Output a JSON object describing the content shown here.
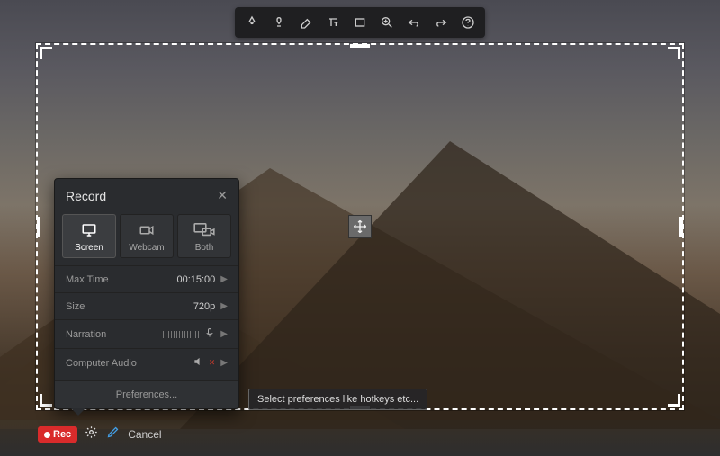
{
  "toolbar": {
    "icons": [
      "pen-tool",
      "highlighter",
      "eraser",
      "text",
      "rectangle",
      "zoom",
      "undo",
      "redo",
      "help"
    ]
  },
  "panel": {
    "title": "Record",
    "sources": [
      {
        "label": "Screen",
        "icon": "monitor-icon",
        "active": true
      },
      {
        "label": "Webcam",
        "icon": "webcam-icon",
        "active": false
      },
      {
        "label": "Both",
        "icon": "both-icon",
        "active": false
      }
    ],
    "rows": {
      "maxtime_label": "Max Time",
      "maxtime_value": "00:15:00",
      "size_label": "Size",
      "size_value": "720p",
      "narration_label": "Narration",
      "audio_label": "Computer Audio"
    },
    "prefs_label": "Preferences..."
  },
  "tooltip": "Select preferences like hotkeys etc...",
  "bottombar": {
    "rec_label": "Rec",
    "cancel_label": "Cancel"
  }
}
